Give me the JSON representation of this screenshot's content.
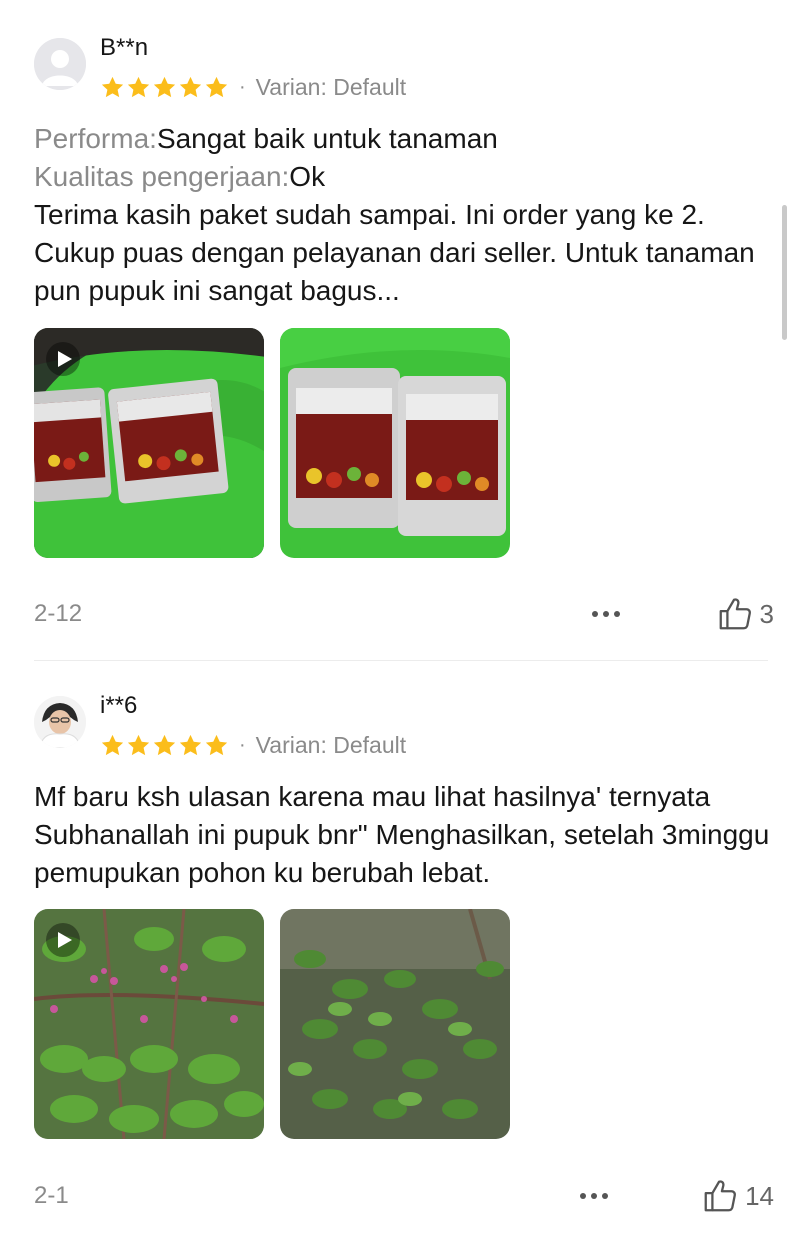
{
  "colors": {
    "star": "#fbbd1b",
    "meta": "#8a8a8a",
    "text": "#161616"
  },
  "reviews": [
    {
      "username": "B**n",
      "rating": 5,
      "rating_max": 5,
      "separator": "·",
      "variant": "Varian: Default",
      "attributes": [
        {
          "label": "Performa:",
          "value": "Sangat baik untuk tanaman"
        },
        {
          "label": "Kualitas pengerjaan:",
          "value": "Ok"
        }
      ],
      "body": "Terima kasih paket sudah sampai. Ini order yang ke 2. Cukup puas dengan pelayanan dari seller. Untuk tanaman pun pupuk ini sangat bagus...",
      "media": [
        {
          "kind": "video",
          "icon": "play-icon"
        },
        {
          "kind": "image"
        }
      ],
      "date": "2-12",
      "likes": "3"
    },
    {
      "username": "i**6",
      "rating": 5,
      "rating_max": 5,
      "separator": "·",
      "variant": "Varian: Default",
      "body": "Mf baru ksh ulasan karena mau lihat hasilnya' ternyata Subhanallah ini pupuk bnr\" Menghasilkan, setelah 3minggu pemupukan pohon ku berubah lebat.",
      "media": [
        {
          "kind": "video",
          "icon": "play-icon"
        },
        {
          "kind": "image"
        }
      ],
      "date": "2-1",
      "likes": "14"
    }
  ],
  "icons": [
    "default-avatar-icon",
    "star-icon",
    "play-icon",
    "more-options-icon",
    "thumbs-up-icon"
  ]
}
